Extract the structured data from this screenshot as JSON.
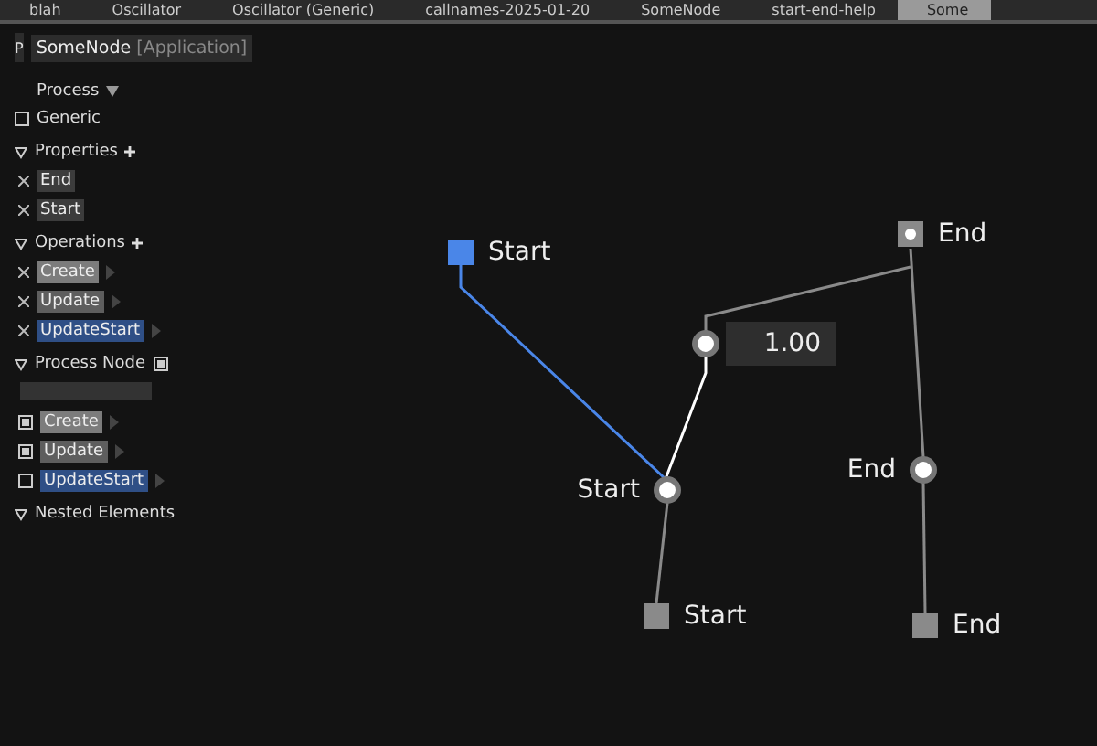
{
  "tabs": [
    {
      "label": "blah",
      "selected": false
    },
    {
      "label": "Oscillator",
      "selected": false
    },
    {
      "label": "Oscillator (Generic)",
      "selected": false
    },
    {
      "label": "callnames-2025-01-20",
      "selected": false
    },
    {
      "label": "SomeNode",
      "selected": false
    },
    {
      "label": "start-end-help",
      "selected": false
    },
    {
      "label": "Some",
      "selected": true
    }
  ],
  "header": {
    "badge": "P",
    "title": "SomeNode",
    "type": "[Application]"
  },
  "sidebar": {
    "title": "Process",
    "generic": {
      "label": "Generic",
      "checked": false
    },
    "sections": [
      {
        "label": "Properties",
        "expanded": true,
        "addable": true,
        "items": [
          {
            "kind": "removable",
            "label": "End",
            "color": "#3c3c3c"
          },
          {
            "kind": "removable",
            "label": "Start",
            "color": "#3c3c3c"
          }
        ]
      },
      {
        "label": "Operations",
        "expanded": true,
        "addable": true,
        "items": [
          {
            "kind": "removable",
            "label": "Create",
            "color": "#7c7c7c"
          },
          {
            "kind": "removable",
            "label": "Update",
            "color": "#5e5e5e"
          },
          {
            "kind": "removable",
            "label": "UpdateStart",
            "color": "#2f4f86"
          }
        ]
      },
      {
        "label": "Process Node",
        "expanded": true,
        "checked": true,
        "field": true,
        "items": [
          {
            "kind": "check",
            "label": "Create",
            "checked": true,
            "color": "#7c7c7c"
          },
          {
            "kind": "check",
            "label": "Update",
            "checked": true,
            "color": "#5e5e5e"
          },
          {
            "kind": "check",
            "label": "UpdateStart",
            "checked": false,
            "color": "#2f4f86"
          }
        ]
      },
      {
        "label": "Nested Elements",
        "expanded": true
      }
    ]
  },
  "graph": {
    "nodes": [
      {
        "kind": "square",
        "label": "Start",
        "color": "#4a86e8",
        "dot": false
      },
      {
        "kind": "square",
        "label": "End",
        "color": "#8a8a8a",
        "dot": true
      },
      {
        "kind": "value",
        "value": "1.00"
      },
      {
        "kind": "circle",
        "label": "Start"
      },
      {
        "kind": "circle",
        "label": "End"
      },
      {
        "kind": "square",
        "label": "Start",
        "color": "#8a8a8a",
        "dot": false
      },
      {
        "kind": "square",
        "label": "End",
        "color": "#8a8a8a",
        "dot": false
      }
    ],
    "connections": [
      {
        "color": "#4a86e8"
      },
      {
        "color": "#ffffff"
      },
      {
        "color": "#8a8a8a"
      },
      {
        "color": "#8a8a8a"
      },
      {
        "color": "#8a8a8a"
      },
      {
        "color": "#8a8a8a"
      }
    ]
  }
}
